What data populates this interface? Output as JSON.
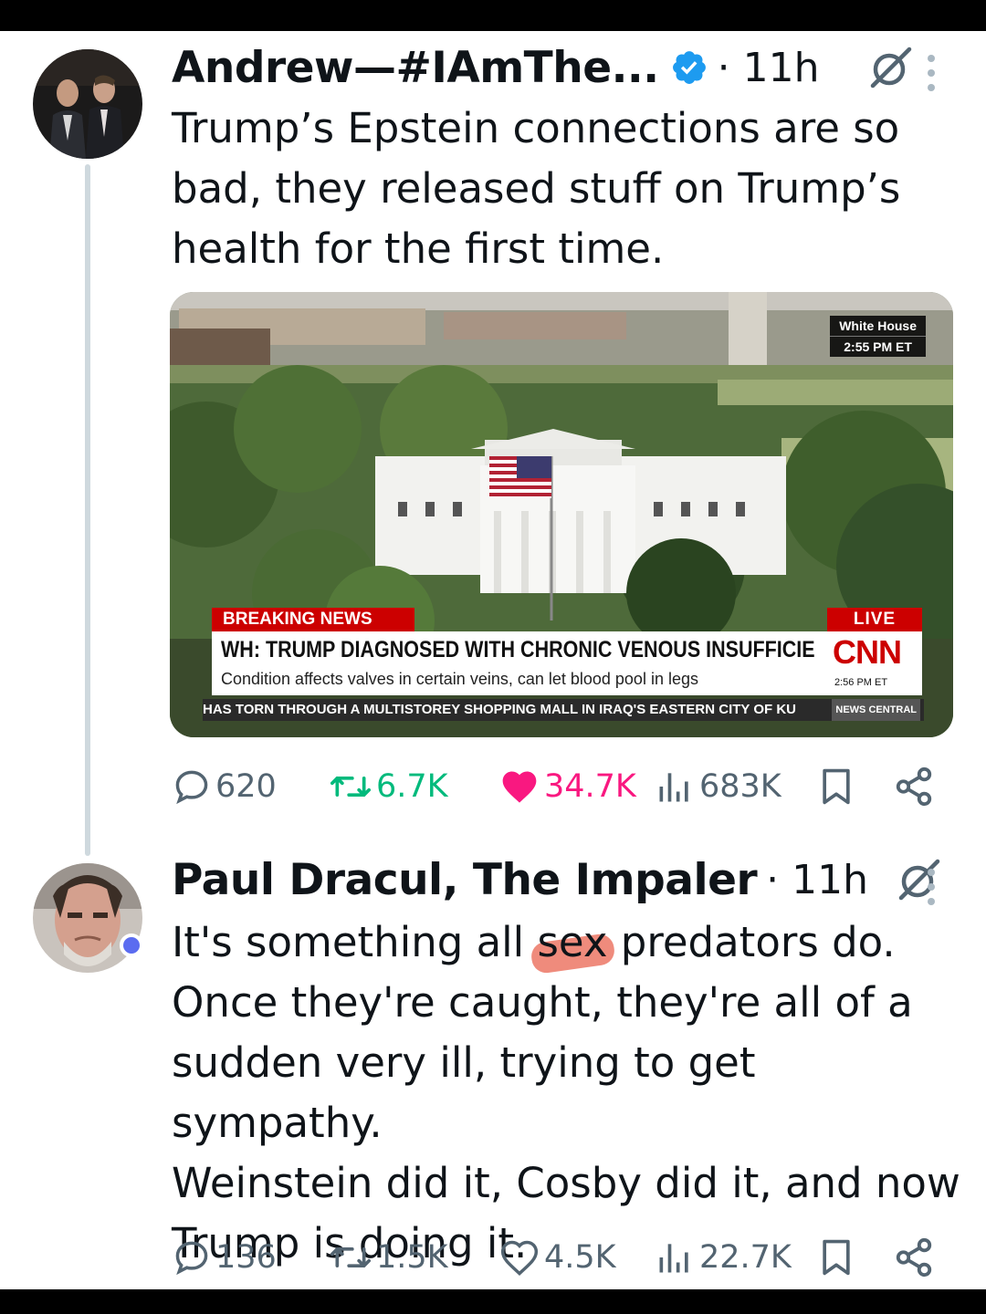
{
  "tweets": [
    {
      "author": "Andrew—#IAmThe...",
      "verified": true,
      "time": "· 11h",
      "text": "Trump’s Epstein connections are so\nbad, they released stuff on Trump’s\nhealth for the first time.",
      "media": {
        "location_bug": "White House",
        "bug_time": "2:55 PM ET",
        "breaking": "BREAKING NEWS",
        "live": "LIVE",
        "headline": "WH: TRUMP DIAGNOSED WITH CHRONIC VENOUS INSUFFICIENCY",
        "subline": "Condition affects valves in certain veins, can let blood pool in legs",
        "network": "CNN",
        "network_time": "2:56 PM ET",
        "ticker": "HAS TORN THROUGH A MULTISTOREY SHOPPING MALL IN IRAQ'S EASTERN CITY OF KU",
        "ticker_badge": "NEWS CENTRAL"
      },
      "stats": {
        "replies": "620",
        "reposts": "6.7K",
        "likes": "34.7K",
        "views": "683K"
      },
      "liked": true
    },
    {
      "author": "Paul Dracul, The Impaler",
      "verified": false,
      "time": "· 11h",
      "text_before": "It's something all ",
      "text_highlight": "sex",
      "text_after": " predators do.\nOnce they're caught, they're all of a\nsudden very ill, trying to get sympathy.\nWeinstein did it, Cosby did it, and now\nTrump is doing it.",
      "stats": {
        "replies": "136",
        "reposts": "1.5K",
        "likes": "4.5K",
        "views": "22.7K"
      },
      "liked": false
    }
  ],
  "colors": {
    "like_active": "#f91880",
    "verified_blue": "#1d9bf0",
    "muted": "#536471",
    "thread_line": "#cfd9de",
    "cnn_red": "#cc0000"
  },
  "icons": [
    "reply-icon",
    "repost-icon",
    "like-icon",
    "views-icon",
    "bookmark-icon",
    "share-icon",
    "grok-icon",
    "more-icon",
    "verified-badge-icon"
  ]
}
